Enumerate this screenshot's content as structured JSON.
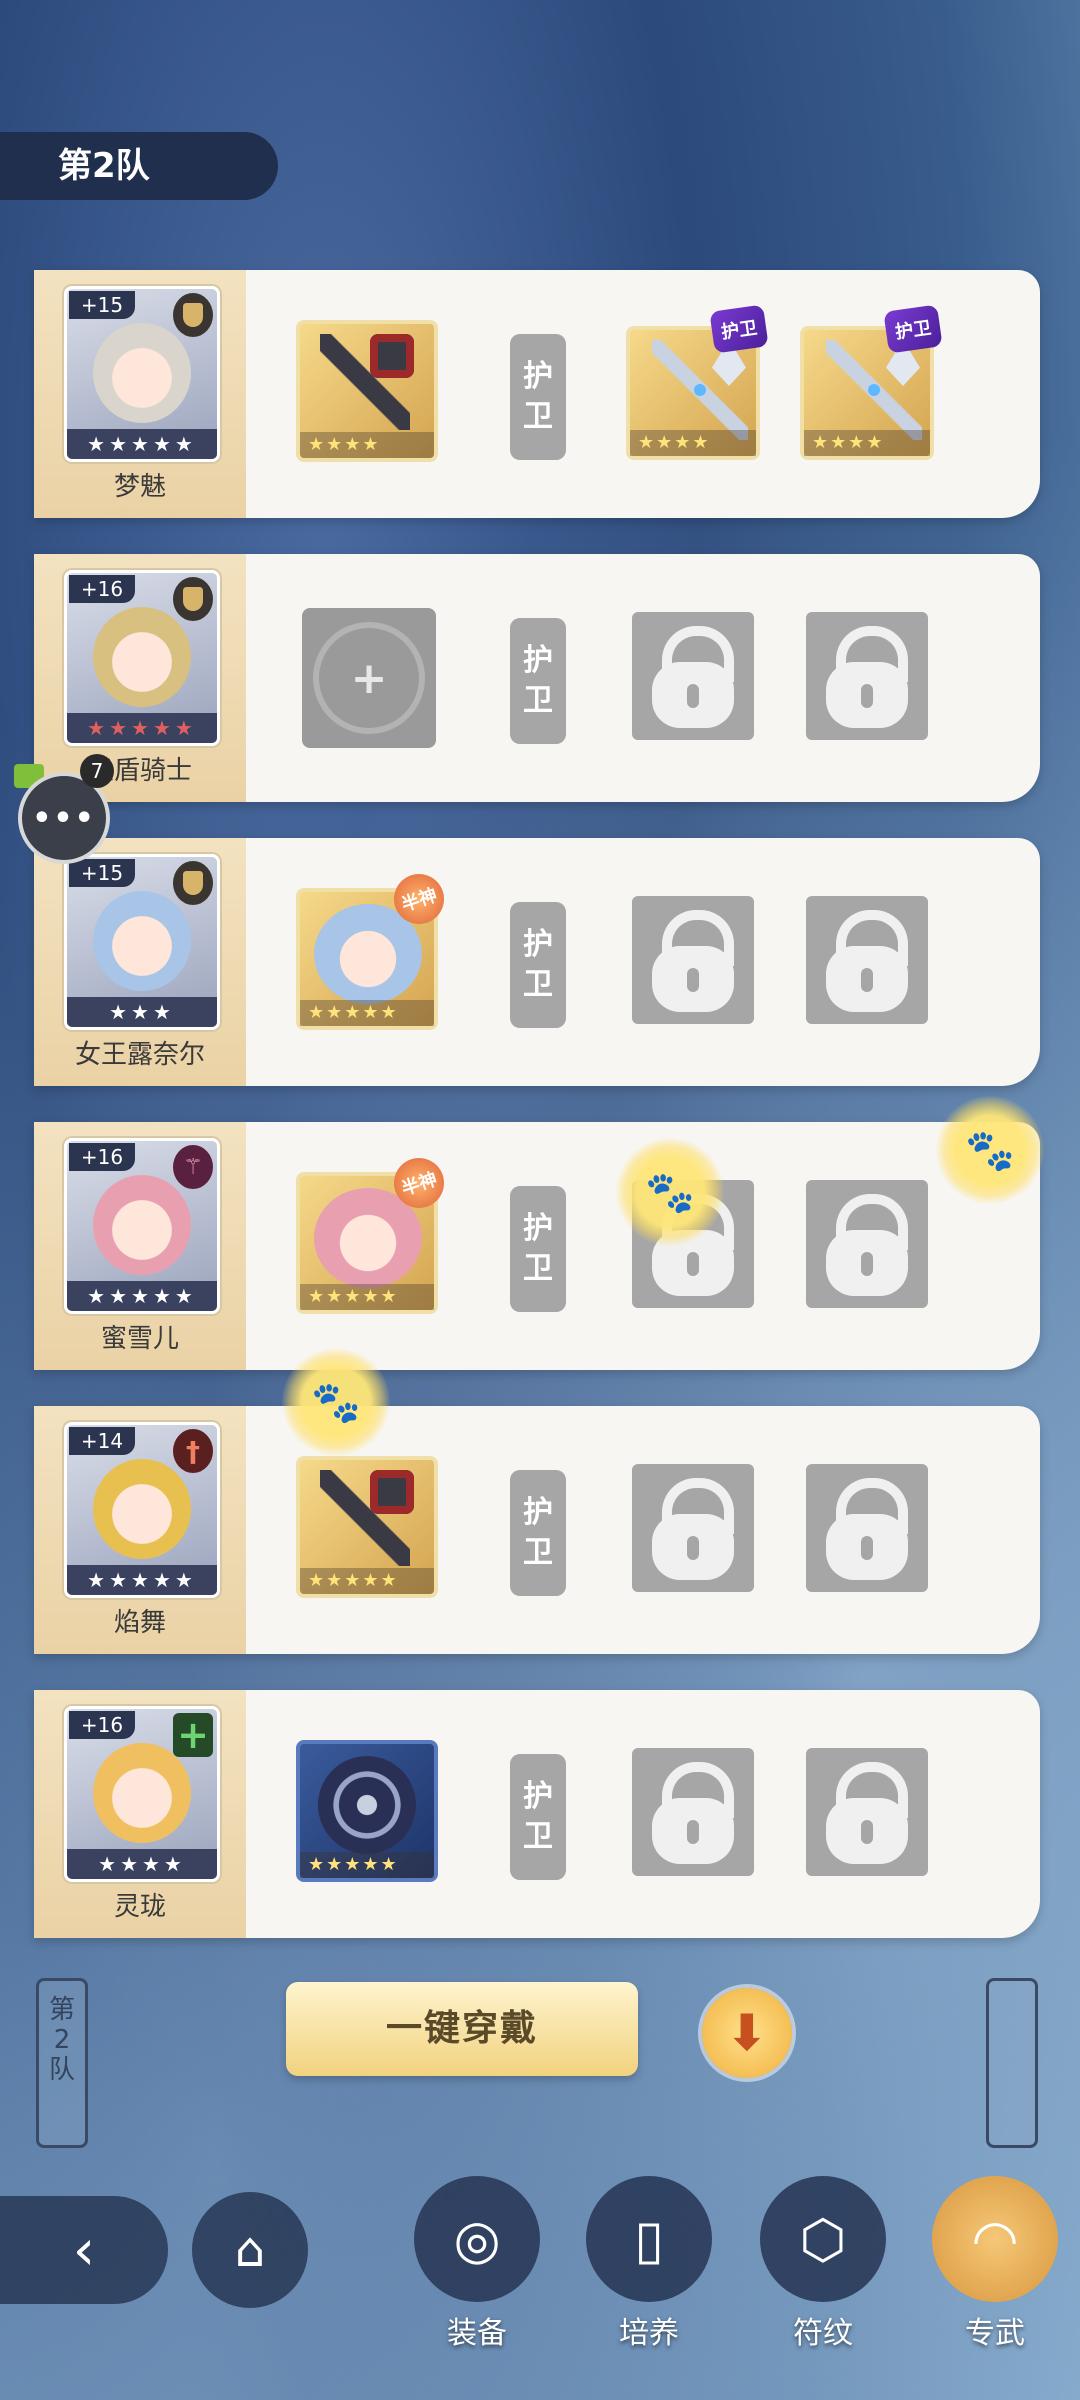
{
  "team_tag": "第2队",
  "guard_label_top": "护",
  "guard_label_bottom": "卫",
  "slot_tags": {
    "guard": "护卫",
    "demigod": "半神"
  },
  "heroes": [
    {
      "name": "梦魅",
      "level": "+15",
      "stars": "★★★★★",
      "role_icon": "shield-icon"
    },
    {
      "name": "圣盾骑士",
      "level": "+16",
      "stars": "★★★★★",
      "role_icon": "shield-icon"
    },
    {
      "name": "女王露奈尔",
      "level": "+15",
      "stars": "★★★",
      "role_icon": "shield-icon"
    },
    {
      "name": "蜜雪儿",
      "level": "+16",
      "stars": "★★★★★",
      "role_icon": "staff-icon"
    },
    {
      "name": "焰舞",
      "level": "+14",
      "stars": "★★★★★",
      "role_icon": "sword-icon"
    },
    {
      "name": "灵珑",
      "level": "+16",
      "stars": "★★★★",
      "role_icon": "heal-cross-icon"
    }
  ],
  "slot_stars": {
    "r1_weapon": "★★★★",
    "r1_spear1": "★★★★",
    "r1_spear2": "★★★★",
    "r3_portrait": "★★★★★",
    "r4_portrait": "★★★★★",
    "r5_weapon": "★★★★★",
    "r6_shield": "★★★★★"
  },
  "chat_badge_count": "7",
  "chat_dots": "•••",
  "side_left_label": [
    "第",
    "2",
    "队"
  ],
  "wear_all_button": "一键穿戴",
  "nav": [
    {
      "label": "装备",
      "icon": "paw-coin-icon"
    },
    {
      "label": "培养",
      "icon": "card-icon"
    },
    {
      "label": "符纹",
      "icon": "rune-icon"
    },
    {
      "label": "专武",
      "icon": "horn-icon"
    }
  ],
  "colors": {
    "accent": "#f1d27e",
    "panel": "#f7f6f3",
    "dark": "#1f2f4d"
  }
}
